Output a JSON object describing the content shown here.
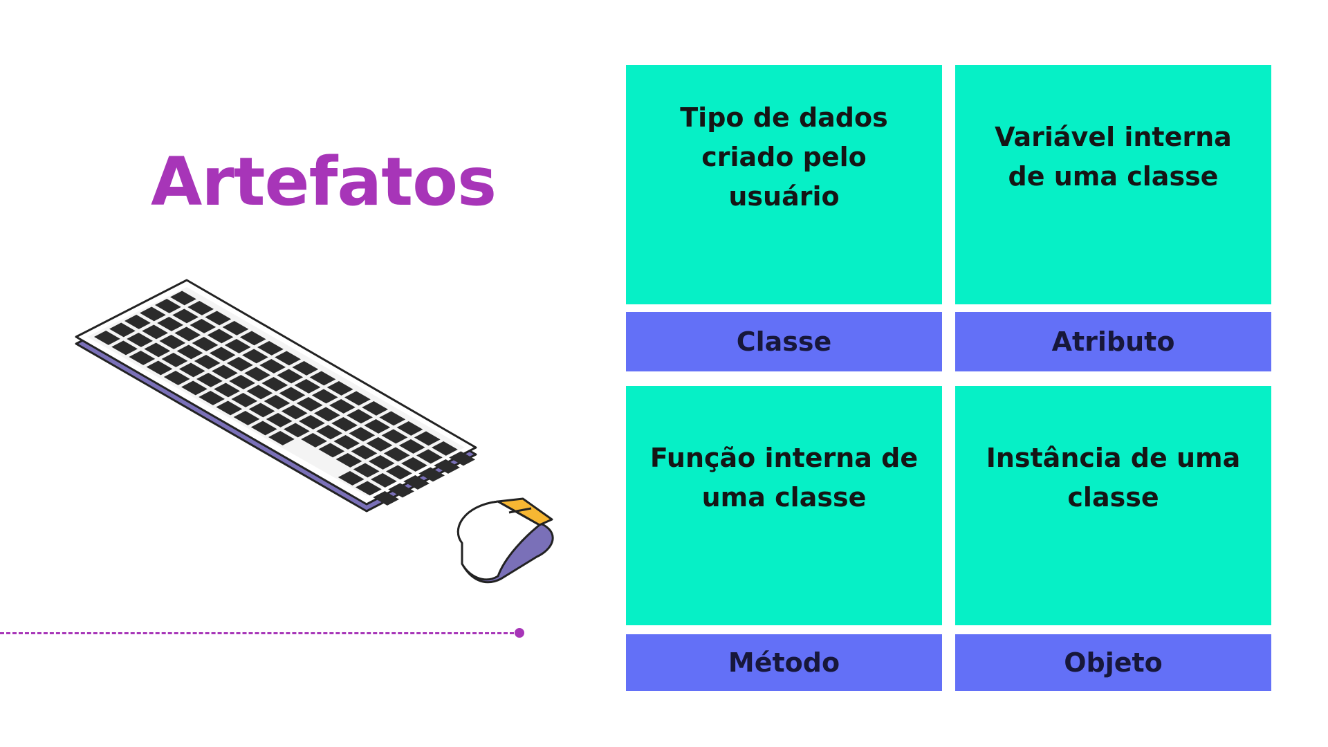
{
  "slide": {
    "title": "Artefatos",
    "colors": {
      "title": "#a735b8",
      "definition_bg": "#06f0c6",
      "term_bg": "#6370f7",
      "term_text": "#17173a",
      "accent_line": "#a735b8"
    },
    "illustration": [
      "keyboard-icon",
      "mouse-icon"
    ],
    "cards": [
      {
        "definition": "Tipo de dados criado pelo usuário",
        "term": "Classe"
      },
      {
        "definition": "Variável interna de uma classe",
        "term": "Atributo"
      },
      {
        "definition": "Função interna de uma classe",
        "term": "Método"
      },
      {
        "definition": "Instância de uma classe",
        "term": "Objeto"
      }
    ]
  }
}
